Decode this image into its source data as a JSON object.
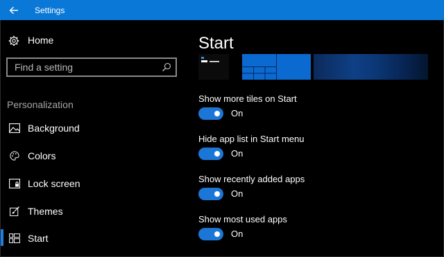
{
  "window": {
    "title": "Settings"
  },
  "sidebar": {
    "home_label": "Home",
    "search": {
      "placeholder": "Find a setting",
      "value": ""
    },
    "section_title": "Personalization",
    "items": [
      {
        "label": "Background",
        "icon": "picture-icon",
        "active": false
      },
      {
        "label": "Colors",
        "icon": "palette-icon",
        "active": false
      },
      {
        "label": "Lock screen",
        "icon": "lock-screen-icon",
        "active": false
      },
      {
        "label": "Themes",
        "icon": "brush-icon",
        "active": false
      },
      {
        "label": "Start",
        "icon": "start-tiles-icon",
        "active": true
      }
    ]
  },
  "main": {
    "title": "Start",
    "settings": [
      {
        "label": "Show more tiles on Start",
        "state": "On",
        "enabled": true
      },
      {
        "label": "Hide app list in Start menu",
        "state": "On",
        "enabled": true
      },
      {
        "label": "Show recently added apps",
        "state": "On",
        "enabled": true
      },
      {
        "label": "Show most used apps",
        "state": "On",
        "enabled": true
      }
    ]
  },
  "colors": {
    "accent": "#0a78d7",
    "toggle_on": "#1b76d6",
    "background": "#000000"
  }
}
